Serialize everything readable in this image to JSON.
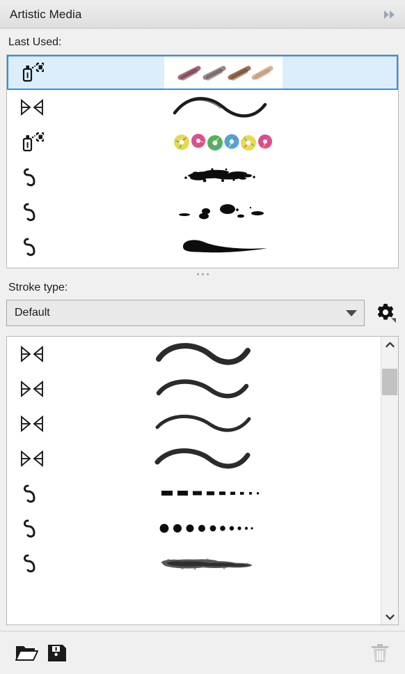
{
  "titlebar": {
    "title": "Artistic Media",
    "collapse_icon": "double-chevron-right-icon"
  },
  "last_used": {
    "label": "Last Used:",
    "items": [
      {
        "icon": "sprayer-icon",
        "preview": "brush-strokes-tan",
        "selected": true
      },
      {
        "icon": "preset-bowtie-icon",
        "preview": "s-curve-calligraphic",
        "selected": false
      },
      {
        "icon": "sprayer-icon",
        "preview": "pinwheel-sprayer-colorful",
        "selected": false
      },
      {
        "icon": "brush-stroke-icon",
        "preview": "splatter-stroke",
        "selected": false
      },
      {
        "icon": "brush-stroke-icon",
        "preview": "ink-blobs-stroke",
        "selected": false
      },
      {
        "icon": "brush-stroke-icon",
        "preview": "teardrop-taper-stroke",
        "selected": false
      }
    ]
  },
  "splitter": {
    "grip_dots": 3
  },
  "stroke_type": {
    "label": "Stroke type:",
    "selected": "Default",
    "options": [
      "Default"
    ],
    "dropdown_icon": "chevron-down-icon",
    "settings_icon": "gear-icon"
  },
  "stroke_list": {
    "items": [
      {
        "icon": "preset-bowtie-icon",
        "preview": "wave-thick-tapered"
      },
      {
        "icon": "preset-bowtie-icon",
        "preview": "wave-medium-tapered"
      },
      {
        "icon": "preset-bowtie-icon",
        "preview": "wave-thin-even"
      },
      {
        "icon": "preset-bowtie-icon",
        "preview": "wave-bold-tapered"
      },
      {
        "icon": "brush-stroke-icon",
        "preview": "dashes-decreasing"
      },
      {
        "icon": "brush-stroke-icon",
        "preview": "dots-decreasing"
      },
      {
        "icon": "brush-stroke-icon",
        "preview": "charcoal-rough-stroke"
      }
    ],
    "scrollbar": {
      "up_icon": "chevron-up-icon",
      "down_icon": "chevron-down-icon",
      "thumb_position": "near-top"
    }
  },
  "footer": {
    "buttons": [
      {
        "name": "browse",
        "icon": "folder-open-icon",
        "enabled": true
      },
      {
        "name": "save",
        "icon": "floppy-save-icon",
        "enabled": true
      },
      {
        "name": "delete",
        "icon": "trash-icon",
        "enabled": false
      }
    ]
  },
  "colors": {
    "panel_bg": "#f0f0f0",
    "titlebar_bg": "#e6e6e6",
    "list_bg": "#ffffff",
    "selection_fill": "#dceefc",
    "selection_border": "#2196f3",
    "border": "#b8b8b8",
    "text": "#1c1c1c",
    "icon_dark": "#1a1a1a",
    "icon_disabled": "#bdbdbd",
    "scrollbar_thumb": "#c2c2c2",
    "combo_bg": "#e9e9e9"
  }
}
